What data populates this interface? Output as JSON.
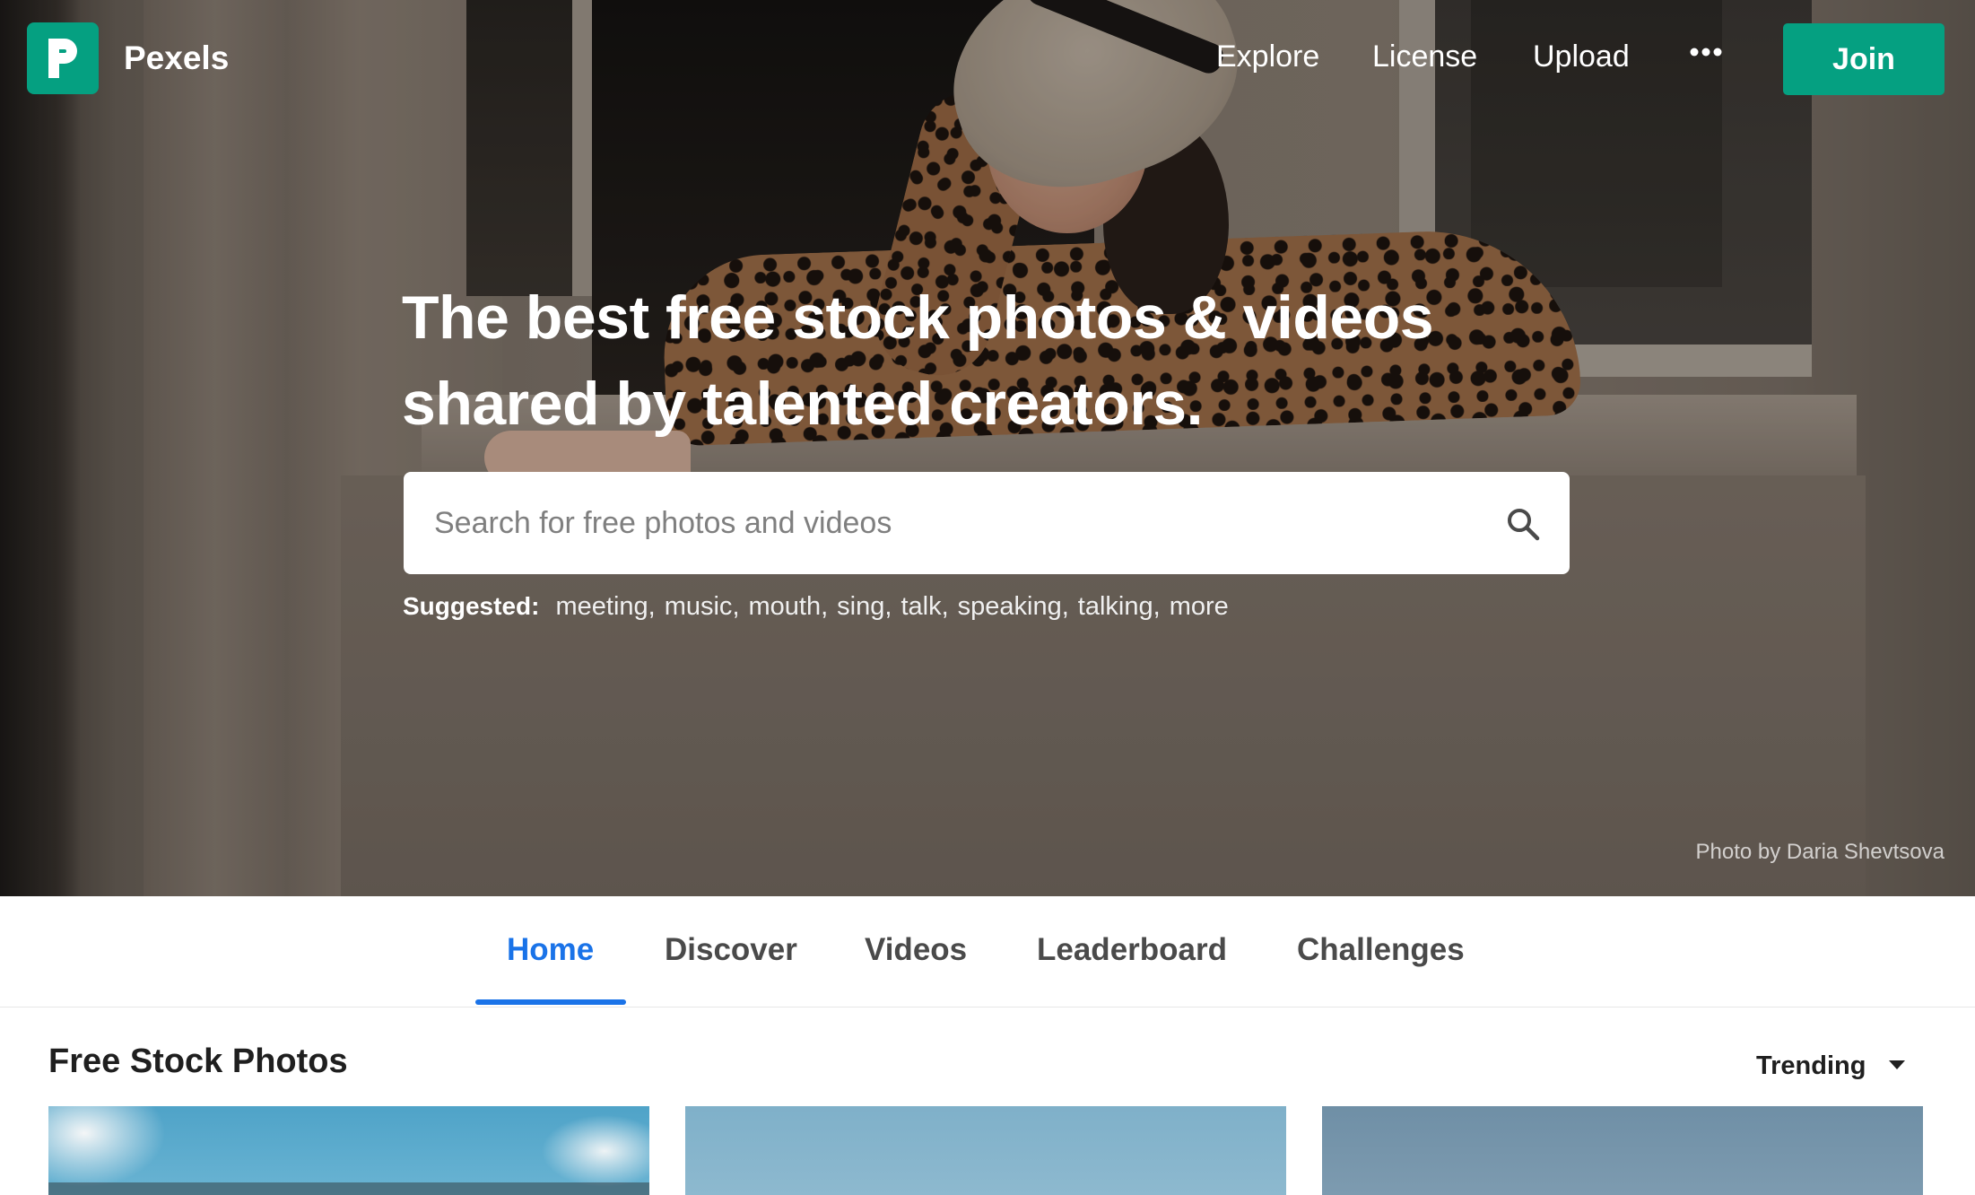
{
  "brand": {
    "name": "Pexels",
    "accent_color": "#05a081",
    "logo_letter": "P"
  },
  "nav": {
    "links": [
      "Explore",
      "License",
      "Upload"
    ],
    "more_icon": "more-horizontal-icon",
    "join_label": "Join"
  },
  "hero": {
    "headline_line1": "The best free stock photos & videos",
    "headline_line2": "shared by talented creators.",
    "search": {
      "placeholder": "Search for free photos and videos",
      "value": "",
      "icon": "search-icon"
    },
    "suggested": {
      "label": "Suggested:",
      "items": [
        "meeting",
        "music",
        "mouth",
        "sing",
        "talk",
        "speaking",
        "talking",
        "more"
      ]
    },
    "photo_credit": "Photo by Daria Shevtsova"
  },
  "tabs": {
    "items": [
      "Home",
      "Discover",
      "Videos",
      "Leaderboard",
      "Challenges"
    ],
    "active": "Home",
    "active_color": "#1a73e8"
  },
  "section": {
    "title": "Free Stock Photos",
    "sort_label": "Trending",
    "sort_icon": "caret-down-icon"
  }
}
